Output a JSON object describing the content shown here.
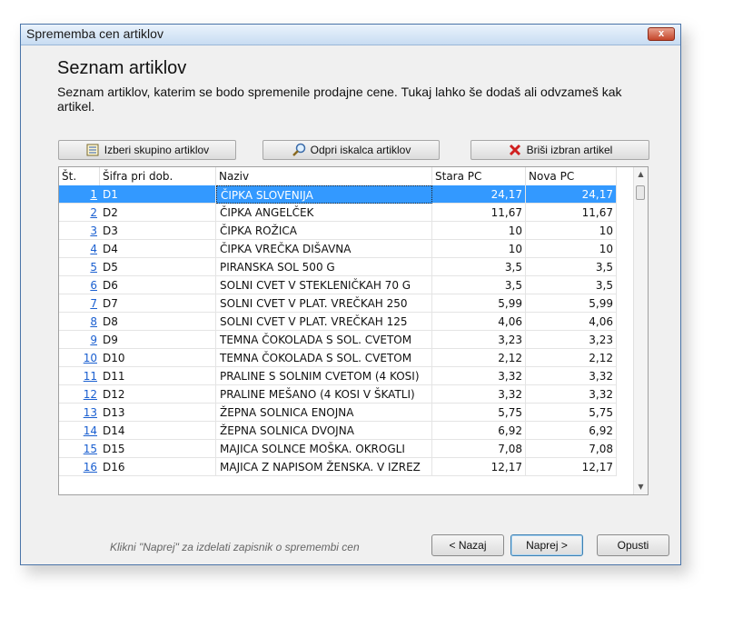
{
  "window": {
    "title": "Sprememba cen artiklov",
    "close_label": "x"
  },
  "page": {
    "title": "Seznam artiklov",
    "description": "Seznam artiklov, katerim se bodo spremenile prodajne cene. Tukaj lahko še dodaš ali odvzameš kak artikel."
  },
  "toolbar": {
    "group_label": "Izberi skupino artiklov",
    "search_label": "Odpri iskalca artiklov",
    "delete_label": "Briši izbran artikel"
  },
  "table": {
    "columns": [
      "Št.",
      "Šifra pri dob.",
      "Naziv",
      "Stara PC",
      "Nova PC"
    ],
    "rows": [
      {
        "num": "1",
        "sifra": "D1",
        "naziv": "ČIPKA SLOVENIJA",
        "stara": "24,17",
        "nova": "24,17"
      },
      {
        "num": "2",
        "sifra": "D2",
        "naziv": "ČIPKA ANGELČEK",
        "stara": "11,67",
        "nova": "11,67"
      },
      {
        "num": "3",
        "sifra": "D3",
        "naziv": "ČIPKA ROŽICA",
        "stara": "10",
        "nova": "10"
      },
      {
        "num": "4",
        "sifra": "D4",
        "naziv": "ČIPKA VREČKA DIŠAVNA",
        "stara": "10",
        "nova": "10"
      },
      {
        "num": "5",
        "sifra": "D5",
        "naziv": "PIRANSKA SOL 500 G",
        "stara": "3,5",
        "nova": "3,5"
      },
      {
        "num": "6",
        "sifra": "D6",
        "naziv": "SOLNI CVET V STEKLENIČKAH  70 G",
        "stara": "3,5",
        "nova": "3,5"
      },
      {
        "num": "7",
        "sifra": "D7",
        "naziv": "SOLNI CVET V PLAT. VREČKAH 250",
        "stara": "5,99",
        "nova": "5,99"
      },
      {
        "num": "8",
        "sifra": "D8",
        "naziv": "SOLNI CVET V PLAT. VREČKAH 125",
        "stara": "4,06",
        "nova": "4,06"
      },
      {
        "num": "9",
        "sifra": "D9",
        "naziv": "TEMNA ČOKOLADA S SOL. CVETOM",
        "stara": "3,23",
        "nova": "3,23"
      },
      {
        "num": "10",
        "sifra": "D10",
        "naziv": "TEMNA ČOKOLADA S SOL. CVETOM",
        "stara": "2,12",
        "nova": "2,12"
      },
      {
        "num": "11",
        "sifra": "D11",
        "naziv": "PRALINE S SOLNIM CVETOM (4 KOSI)",
        "stara": "3,32",
        "nova": "3,32"
      },
      {
        "num": "12",
        "sifra": "D12",
        "naziv": "PRALINE MEŠANO (4 KOSI V ŠKATLI)",
        "stara": "3,32",
        "nova": "3,32"
      },
      {
        "num": "13",
        "sifra": "D13",
        "naziv": "ŽEPNA SOLNICA ENOJNA",
        "stara": "5,75",
        "nova": "5,75"
      },
      {
        "num": "14",
        "sifra": "D14",
        "naziv": "ŽEPNA SOLNICA DVOJNA",
        "stara": "6,92",
        "nova": "6,92"
      },
      {
        "num": "15",
        "sifra": "D15",
        "naziv": "MAJICA SOLNCE MOŠKA. OKROGLI",
        "stara": "7,08",
        "nova": "7,08"
      },
      {
        "num": "16",
        "sifra": "D16",
        "naziv": "MAJICA Z NAPISOM ŽENSKA. V IZREZ",
        "stara": "12,17",
        "nova": "12,17"
      }
    ]
  },
  "footer": {
    "hint": "Klikni \"Naprej\" za izdelati zapisnik o spremembi cen",
    "back_label": "< Nazaj",
    "next_label": "Naprej >",
    "cancel_label": "Opusti"
  },
  "colors": {
    "selection": "#3399ff",
    "link": "#1a5fd0",
    "delete_icon": "#d02020"
  }
}
